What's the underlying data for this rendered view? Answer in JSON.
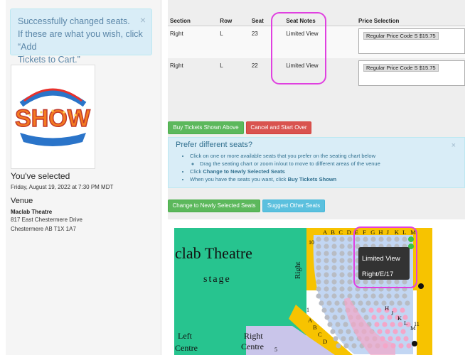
{
  "alert": {
    "line1": "Successfully changed seats.",
    "line2": "If these are what you wish, click “Add",
    "line3": "Tickets to Cart.”",
    "close": "×"
  },
  "selection": {
    "heading": "You've selected",
    "date": "Friday, August 19, 2022 at 7:30 PM MDT",
    "venue_heading": "Venue",
    "venue_name": "Maclab Theatre",
    "venue_address": "817 East Chestermere Drive",
    "venue_city": "Chestermere AB T1X 1A7"
  },
  "logo_text": "SHOW",
  "table": {
    "headers": [
      "Section",
      "Row",
      "Seat",
      "Seat Notes",
      "Price Selection"
    ],
    "rows": [
      {
        "section": "Right",
        "row": "L",
        "seat": "23",
        "notes": "Limited View",
        "price": "Regular Price Code S $15.75"
      },
      {
        "section": "Right",
        "row": "L",
        "seat": "22",
        "notes": "Limited View",
        "price": "Regular Price Code S $15.75"
      }
    ]
  },
  "buttons": {
    "buy": "Buy Tickets Shown Above",
    "cancel": "Cancel and Start Over",
    "change": "Change to Newly Selected Seats",
    "suggest": "Suggest Other Seats"
  },
  "prefer": {
    "title": "Prefer different seats?",
    "close": "×",
    "item1": "Click on one or more available seats that you prefer on the seating chart below",
    "item1a": "Drag the seating chart or zoom in/out to move to different areas of the venue",
    "item2_prefix": "Click ",
    "item2_bold": "Change to Newly Selected Seats",
    "item3_prefix": "When you have the seats you want, click ",
    "item3_bold": "Buy Tickets Shown"
  },
  "map": {
    "title": "clab Theatre",
    "stage": "stage",
    "right_label": "Right",
    "left_centre": "Left",
    "left_centre2": "Centre",
    "right_centre": "Right",
    "right_centre2": "Centre",
    "row_letters_top": [
      "A",
      "B",
      "C",
      "D",
      "E",
      "F",
      "G",
      "H",
      "J",
      "K",
      "L",
      "M"
    ],
    "row_letters_side": [
      "A",
      "B",
      "C",
      "D"
    ],
    "row_letters_right": [
      "H",
      "J",
      "K",
      "L",
      "M"
    ],
    "num_10": "10",
    "num_1": "1",
    "num_5": "5",
    "num_11": "11",
    "tooltip_line1": "Limited View",
    "tooltip_line2": "Right/E/17",
    "colors": {
      "stage": "#27c48f",
      "aisle": "#f7c300",
      "seat_grey": "#b8bcc4",
      "seat_pink": "#f4a6c8",
      "seat_blue": "#c2d6f3"
    }
  }
}
